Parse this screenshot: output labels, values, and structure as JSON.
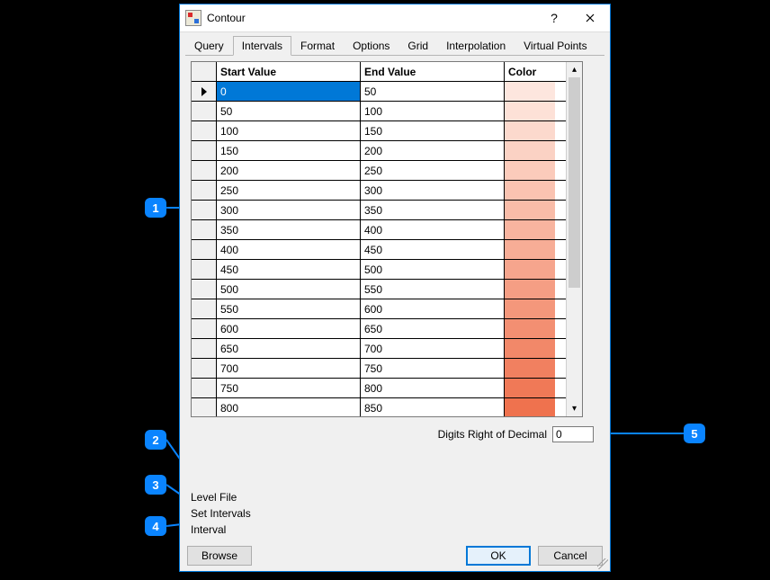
{
  "window": {
    "title": "Contour",
    "help_glyph": "?",
    "close_label": "Close"
  },
  "tabs": [
    {
      "label": "Query",
      "active": false
    },
    {
      "label": "Intervals",
      "active": true
    },
    {
      "label": "Format",
      "active": false
    },
    {
      "label": "Options",
      "active": false
    },
    {
      "label": "Grid",
      "active": false
    },
    {
      "label": "Interpolation",
      "active": false
    },
    {
      "label": "Virtual Points",
      "active": false
    }
  ],
  "grid": {
    "columns": {
      "start": "Start Value",
      "end": "End Value",
      "color": "Color"
    },
    "rows": [
      {
        "start": "0",
        "end": "50",
        "color": "#fde6de",
        "selected": true
      },
      {
        "start": "50",
        "end": "100",
        "color": "#fde1d7"
      },
      {
        "start": "100",
        "end": "150",
        "color": "#fcd9cd"
      },
      {
        "start": "150",
        "end": "200",
        "color": "#fbd2c4"
      },
      {
        "start": "200",
        "end": "250",
        "color": "#fbcbbb"
      },
      {
        "start": "250",
        "end": "300",
        "color": "#fac3b1"
      },
      {
        "start": "300",
        "end": "350",
        "color": "#f9bca8"
      },
      {
        "start": "350",
        "end": "400",
        "color": "#f8b49f"
      },
      {
        "start": "400",
        "end": "450",
        "color": "#f7ad96"
      },
      {
        "start": "450",
        "end": "500",
        "color": "#f6a58d"
      },
      {
        "start": "500",
        "end": "550",
        "color": "#f59e84"
      },
      {
        "start": "550",
        "end": "600",
        "color": "#f4977b"
      },
      {
        "start": "600",
        "end": "650",
        "color": "#f38f72"
      },
      {
        "start": "650",
        "end": "700",
        "color": "#f28869"
      },
      {
        "start": "700",
        "end": "750",
        "color": "#f18060"
      },
      {
        "start": "750",
        "end": "800",
        "color": "#f07957"
      },
      {
        "start": "800",
        "end": "850",
        "color": "#ef724e"
      }
    ]
  },
  "digits": {
    "label": "Digits Right of Decimal",
    "value": "0"
  },
  "links": {
    "level_file": "Level File",
    "set_intervals": "Set Intervals",
    "interval": "Interval"
  },
  "buttons": {
    "browse": "Browse",
    "ok": "OK",
    "cancel": "Cancel"
  },
  "callouts": {
    "c1": "1",
    "c2": "2",
    "c3": "3",
    "c4": "4",
    "c5": "5"
  }
}
